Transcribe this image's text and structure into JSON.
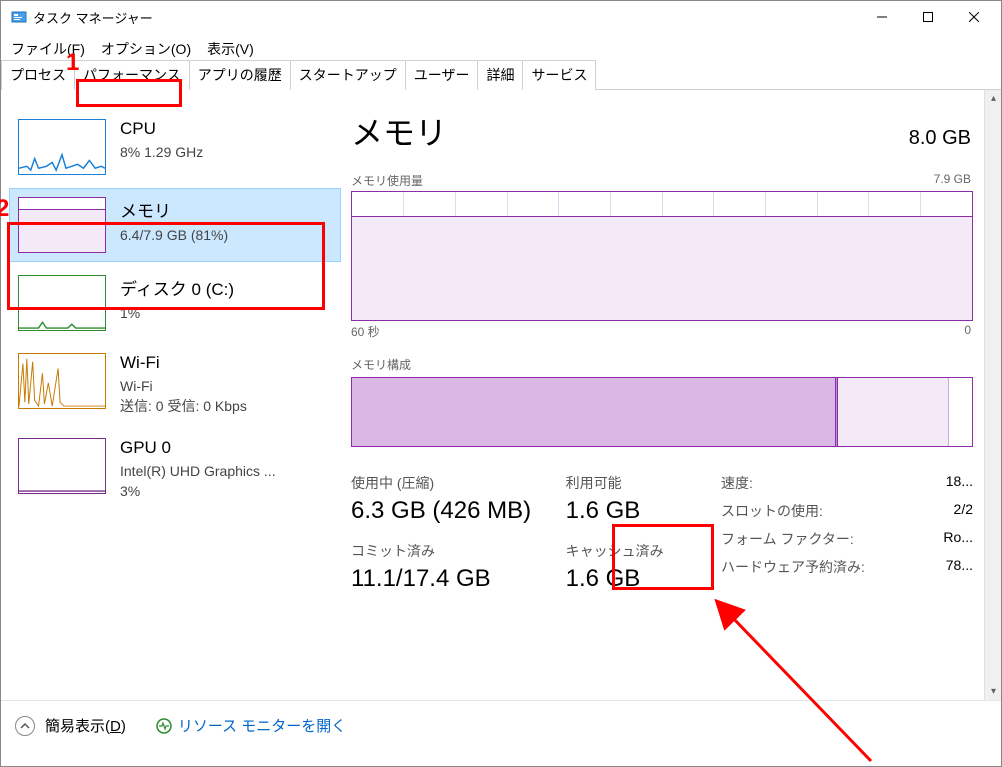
{
  "window": {
    "title": "タスク マネージャー"
  },
  "menu": {
    "file": "ファイル(F)",
    "options": "オプション(O)",
    "view": "表示(V)"
  },
  "tabs": {
    "processes": "プロセス",
    "performance": "パフォーマンス",
    "appHistory": "アプリの履歴",
    "startup": "スタートアップ",
    "users": "ユーザー",
    "details": "詳細",
    "services": "サービス"
  },
  "sidebar": {
    "cpu": {
      "title": "CPU",
      "sub": "8%  1.29 GHz"
    },
    "memory": {
      "title": "メモリ",
      "sub": "6.4/7.9 GB (81%)"
    },
    "disk": {
      "title": "ディスク 0 (C:)",
      "sub": "1%"
    },
    "wifi": {
      "title": "Wi-Fi",
      "sub1": "Wi-Fi",
      "sub2": "送信: 0  受信: 0 Kbps"
    },
    "gpu": {
      "title": "GPU 0",
      "sub1": "Intel(R) UHD Graphics ...",
      "sub2": "3%"
    }
  },
  "detail": {
    "title": "メモリ",
    "total": "8.0 GB",
    "usage_label": "メモリ使用量",
    "usage_max": "7.9 GB",
    "axis_left": "60 秒",
    "axis_right": "0",
    "comp_label": "メモリ構成",
    "stats": {
      "inuse_label": "使用中 (圧縮)",
      "inuse_value": "6.3 GB (426 MB)",
      "avail_label": "利用可能",
      "avail_value": "1.6 GB",
      "committed_label": "コミット済み",
      "committed_value": "11.1/17.4 GB",
      "cached_label": "キャッシュ済み",
      "cached_value": "1.6 GB"
    },
    "info": {
      "speed_label": "速度:",
      "speed_val": "18...",
      "slots_label": "スロットの使用:",
      "slots_val": "2/2",
      "form_label": "フォーム ファクター:",
      "form_val": "Ro...",
      "reserved_label": "ハードウェア予約済み:",
      "reserved_val": "78..."
    }
  },
  "footer": {
    "simple": "簡易表示(D)",
    "resmon": "リソース モニターを開く"
  },
  "annotations": {
    "n1": "1",
    "n2": "2"
  },
  "chart_data": {
    "type": "line",
    "title": "メモリ使用量",
    "xlabel": "秒",
    "ylabel": "GB",
    "xlim": [
      60,
      0
    ],
    "ylim": [
      0,
      7.9
    ],
    "series": [
      {
        "name": "メモリ使用量",
        "values": [
          6.4,
          6.4,
          6.4,
          6.4,
          6.4,
          6.4,
          6.4,
          6.4,
          6.4,
          6.4,
          6.4,
          6.4
        ]
      }
    ],
    "x": [
      60,
      55,
      50,
      45,
      40,
      35,
      30,
      25,
      20,
      15,
      10,
      5
    ]
  }
}
